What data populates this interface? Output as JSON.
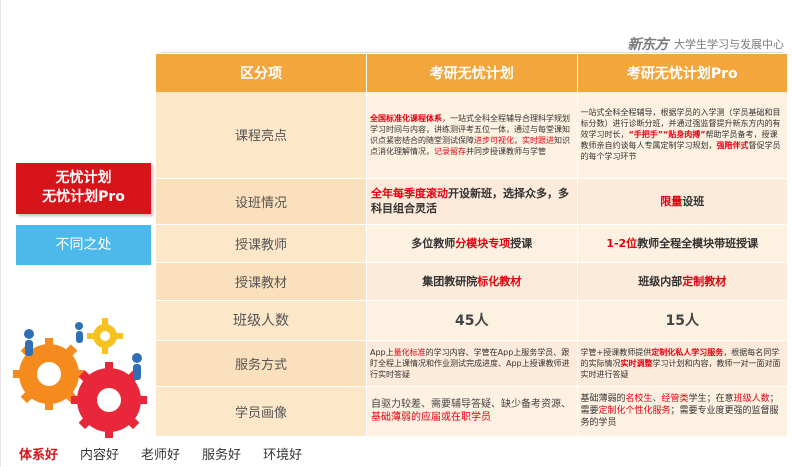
{
  "brand": {
    "logo": "新东方",
    "subtitle": "大学生学习与发展中心"
  },
  "left": {
    "badge_line1": "无忧计划",
    "badge_line2": "无忧计划Pro",
    "diff_label": "不同之处"
  },
  "table": {
    "headers": [
      "区分项",
      "考研无忧计划",
      "考研无忧计划Pro"
    ],
    "rows": {
      "highlights": {
        "label": "课程亮点",
        "a": {
          "p1": "全国标准化课程体系",
          "p2": "，一站式全科全程辅导合理科学规划学习时间与内容，讲练测评考五位一体，通过与每堂课知识点紧密结合的随堂测试保障",
          "p3": "进步可视化",
          "p4": "，",
          "p5": "实时跟进",
          "p6": "知识点消化理解情况，",
          "p7": "记录留存",
          "p8": "并同步授课教师与学管"
        },
        "b": {
          "p1": "一站式全科全程辅导，根据学员的入学测（学员基础和目标分数）进行诊断分班，并通过强监督提升新东方内的有效学习时长，",
          "p2": "“手把手”",
          "p3": "“贴身肉搏”",
          "p4": "帮助学员备考，授课教师亲自约谈每人专属定制学习规划，",
          "p5": "强陪伴式",
          "p6": "督促学员的每个学习环节"
        }
      },
      "classes": {
        "label": "设班情况",
        "a": {
          "p1": "全年每季度滚动",
          "p2": "开设新班，选择众多，多科目组合灵活"
        },
        "b": {
          "p1": "限量",
          "p2": "设班"
        }
      },
      "teachers": {
        "label": "授课教师",
        "a": {
          "p1": "多位教师",
          "p2": "分模块专项",
          "p3": "授课"
        },
        "b": {
          "p1": "1-2位",
          "p2": "教师全程全模块带班授课"
        }
      },
      "materials": {
        "label": "授课教材",
        "a": {
          "p1": "集团教研院",
          "p2": "标化教材"
        },
        "b": {
          "p1": "班级内部",
          "p2": "定制教材"
        }
      },
      "size": {
        "label": "班级人数",
        "a": "45人",
        "b": "15人"
      },
      "service": {
        "label": "服务方式",
        "a": {
          "p1": "App上",
          "p2": "量化标准",
          "p3": "的学习内容、学管在App上服务学员、跟盯全程上课情况和作业测试完成进度、App上授课教师进行实时答疑"
        },
        "b": {
          "p1": "学管+授课教师提供",
          "p2": "定制化私人学习服务",
          "p3": "，根据每名同学的实际情况",
          "p4": "实时调整",
          "p5": "学习计划和内容，教师一对一面对面实时进行答疑"
        }
      },
      "profile": {
        "label": "学员画像",
        "a": {
          "p1": "自驱力较差、需要辅导答疑、缺少备考资源、",
          "p2": "基础薄弱的应届或在职学员"
        },
        "b": {
          "p1": "基础薄弱的",
          "p2": "名校生",
          "p3": "、",
          "p4": "经管类",
          "p5": "学生；在意",
          "p6": "班级人数",
          "p7": "；需要",
          "p8": "定制化个性化服务",
          "p9": "；需要专业度更强的监督服务的学员"
        }
      }
    }
  },
  "tabs": [
    "体系好",
    "内容好",
    "老师好",
    "服务好",
    "环境好"
  ],
  "colors": {
    "header_orange": "#f2a63c",
    "accent_red": "#d7141a",
    "accent_blue": "#4bb9ea"
  }
}
